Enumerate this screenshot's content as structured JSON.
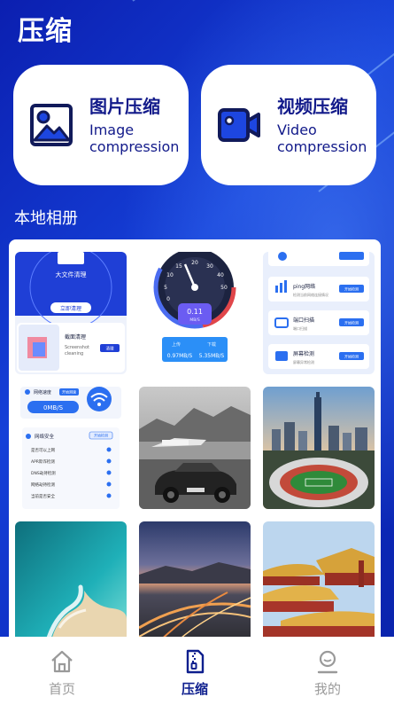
{
  "header": {
    "title": "压缩"
  },
  "features": {
    "image": {
      "title_zh": "图片压缩",
      "title_en_1": "Image",
      "title_en_2": "compression",
      "icon": "image-icon"
    },
    "video": {
      "title_zh": "视频压缩",
      "title_en_1": "Video",
      "title_en_2": "compression",
      "icon": "video-camera-icon"
    }
  },
  "album": {
    "heading": "本地相册",
    "thumbs": {
      "cleanup": {
        "banner": "大文件清理",
        "button": "立即清理",
        "card_title": "截面清理",
        "card_sub_1": "Screenshot",
        "card_sub_2": "cleaning",
        "card_button": "清理"
      },
      "speed": {
        "value": "0.11",
        "unit": "MB/S",
        "up_label": "上传",
        "down_label": "下载",
        "up": "0.97MB/S",
        "down": "5.35MB/S",
        "ticks": [
          "0",
          "5",
          "10",
          "15",
          "20",
          "30",
          "40",
          "50"
        ]
      },
      "tools": {
        "items": [
          {
            "title": "ping网络",
            "sub": "检测当前网络连接情况"
          },
          {
            "title": "端口扫描",
            "sub": "端口扫描"
          },
          {
            "title": "屏幕检测",
            "sub": "屏幕异常检测"
          }
        ],
        "button": "开始检测"
      },
      "netsafe": {
        "speed_label": "网络速度",
        "speed_badge": "开始测速",
        "speed_value": "0MB/S",
        "section_title": "网络安全",
        "section_button": "开始检测",
        "rows": [
          "是否可以上网",
          "APR欺诈检测",
          "DNS劫持检测",
          "网络劫持检测",
          "当前是否安全"
        ]
      }
    }
  },
  "tabs": [
    {
      "label": "首页",
      "icon": "home-icon",
      "active": false
    },
    {
      "label": "压缩",
      "icon": "zip-file-icon",
      "active": true
    },
    {
      "label": "我的",
      "icon": "profile-icon",
      "active": false
    }
  ],
  "colors": {
    "accent": "#0e1f8e",
    "inactive": "#9a9a9a",
    "background": "#1133c8"
  }
}
